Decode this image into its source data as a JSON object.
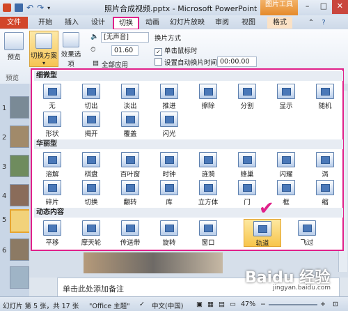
{
  "titlebar": {
    "title": "照片合成视频.pptx - Microsoft PowerPoint",
    "contextual_tab_group": "图片工具",
    "buttons": [
      "–",
      "□",
      "✕"
    ]
  },
  "tabs": {
    "file": "文件",
    "items": [
      "开始",
      "插入",
      "设计",
      "切换",
      "动画",
      "幻灯片放映",
      "审阅",
      "视图",
      "格式"
    ],
    "active": "切换"
  },
  "ribbon": {
    "preview": "预览",
    "preview_group": "预览",
    "scheme": "切换方案",
    "effects": "效果选项",
    "sound": "[无声音]",
    "duration": "01.60",
    "apply_all": "全部应用",
    "switch_mode": "换片方式",
    "on_click": "单击鼠标时",
    "auto_after": "设置自动换片时间:",
    "auto_time": "00:00.00"
  },
  "gallery": {
    "sections": [
      {
        "title": "细微型",
        "items": [
          "无",
          "切出",
          "淡出",
          "推进",
          "擦除",
          "分割",
          "显示",
          "随机",
          "形状",
          "揭开",
          "覆盖",
          "闪光"
        ]
      },
      {
        "title": "华丽型",
        "items": [
          "溶解",
          "棋盘",
          "百叶窗",
          "时钟",
          "涟漪",
          "蜂巢",
          "闪耀",
          "涡",
          "碎片",
          "切换",
          "翻转",
          "库",
          "立方体",
          "门",
          "框",
          "缩"
        ]
      },
      {
        "title": "动态内容",
        "items": [
          "平移",
          "摩天轮",
          "传送带",
          "旋转",
          "窗口",
          "轨道",
          "飞过"
        ]
      }
    ],
    "selected": "轨道"
  },
  "notes": {
    "placeholder": "单击此处添加备注"
  },
  "statusbar": {
    "slide_info": "幻灯片 第 5 张，共 17 张",
    "theme": "\"Office 主题\"",
    "language": "中文(中国)",
    "zoom": "47%"
  },
  "slides": [
    {
      "num": "1"
    },
    {
      "num": "2"
    },
    {
      "num": "3"
    },
    {
      "num": "4"
    },
    {
      "num": "5"
    },
    {
      "num": "6"
    }
  ],
  "watermark": {
    "text": "Baidu 经验",
    "url": "jingyan.baidu.com"
  },
  "colors": {
    "accent": "#e0218a",
    "file_tab": "#d2462a",
    "contextual": "#e58a2a"
  }
}
